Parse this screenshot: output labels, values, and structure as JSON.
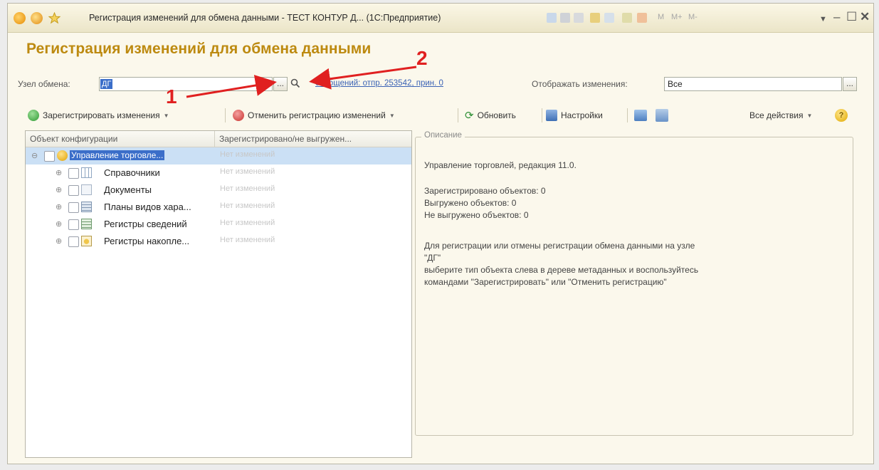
{
  "window": {
    "title": "Регистрация изменений для обмена данными - ТЕСТ КОНТУР Д... (1С:Предприятие)",
    "memory_buttons": [
      "M",
      "M+",
      "M-"
    ]
  },
  "page": {
    "title": "Регистрация изменений для обмена данными"
  },
  "form": {
    "node_label": "Узел обмена:",
    "node_value": "ДГ",
    "select_button": "...",
    "messages_link": "сообщений: отпр. 253542, прин. 0",
    "show_changes_label": "Отображать изменения:",
    "show_changes_value": "Все",
    "show_changes_button": "..."
  },
  "toolbar": {
    "register": "Зарегистрировать изменения",
    "unregister": "Отменить регистрацию изменений",
    "refresh": "Обновить",
    "settings": "Настройки",
    "all_actions": "Все действия",
    "help": "?"
  },
  "tree": {
    "columns": [
      "Объект конфигурации",
      "Зарегистрировано/не выгружен..."
    ],
    "rows": [
      {
        "name": "Управление торговле...",
        "status": "Нет изменений",
        "icon": "configuration-icon"
      },
      {
        "name": "Справочники",
        "status": "Нет изменений",
        "icon": "catalogs-icon"
      },
      {
        "name": "Документы",
        "status": "Нет изменений",
        "icon": "documents-icon"
      },
      {
        "name": "Планы видов хара...",
        "status": "Нет изменений",
        "icon": "characteristics-icon"
      },
      {
        "name": "Регистры сведений",
        "status": "Нет изменений",
        "icon": "info-registers-icon"
      },
      {
        "name": "Регистры накопле...",
        "status": "Нет изменений",
        "icon": "accumulation-registers-icon"
      }
    ]
  },
  "description": {
    "legend": "Описание",
    "lines": [
      "Управление торговлей, редакция 11.0.",
      "Зарегистрировано объектов: 0",
      "Выгружено объектов: 0",
      "Не выгружено объектов: 0",
      "Для регистрации или отмены регистрации обмена данными на узле",
      "\"ДГ\"",
      "выберите тип объекта слева в дереве метаданных и воспользуйтесь",
      "командами \"Зарегистрировать\" или \"Отменить регистрацию\""
    ]
  },
  "annotations": {
    "label_1": "1",
    "label_2": "2",
    "color": "#e02020"
  }
}
